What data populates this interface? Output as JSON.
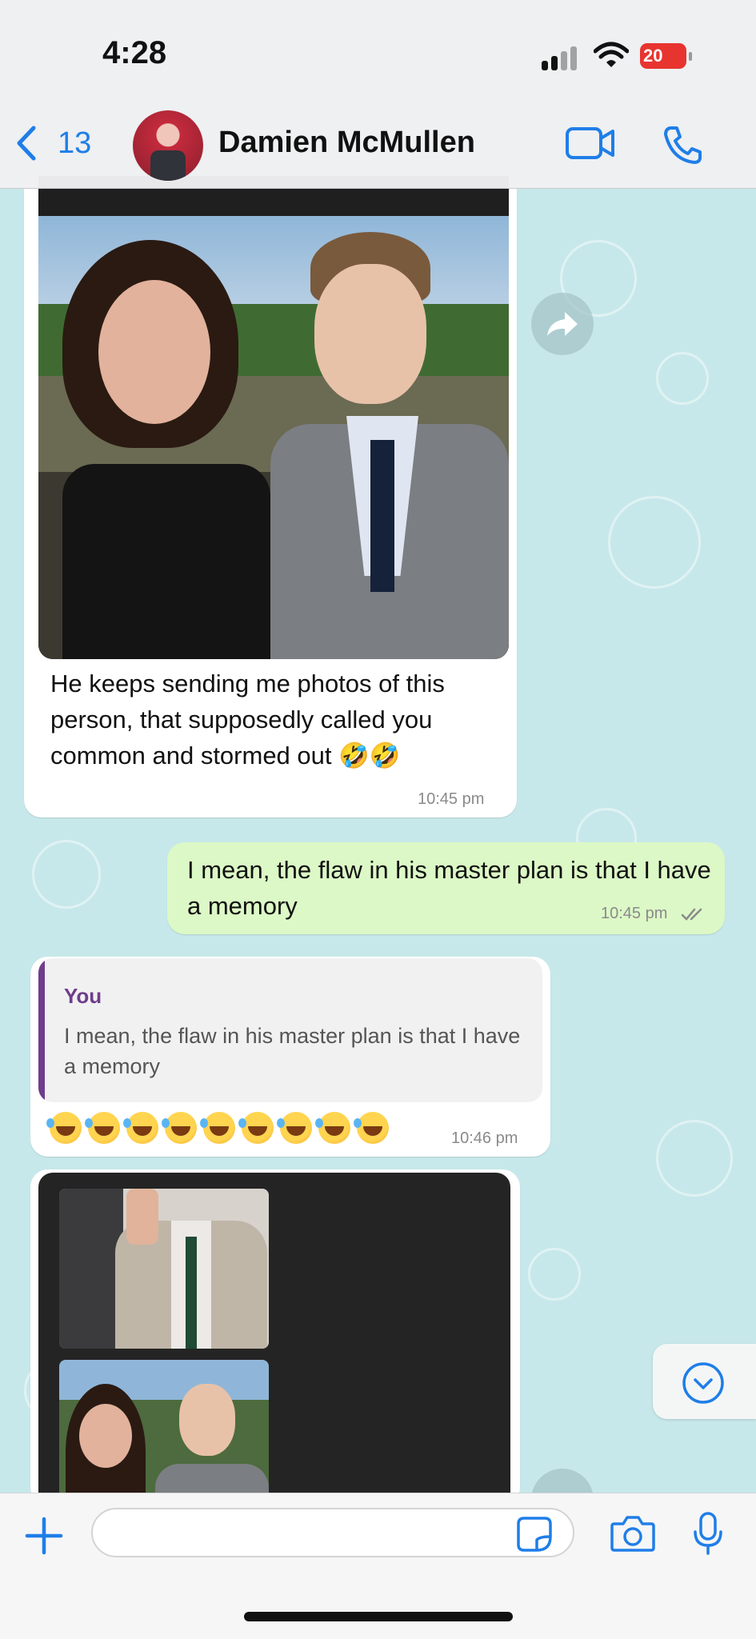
{
  "status_bar": {
    "time": "4:28",
    "battery": "20"
  },
  "header": {
    "back_count": "13",
    "contact_name": "Damien McMullen"
  },
  "messages": [
    {
      "direction": "in",
      "type": "photo_caption",
      "caption": "He keeps sending me photos of this person, that supposedly called you common and stormed out 🤣🤣",
      "time": "10:45 pm"
    },
    {
      "direction": "out",
      "type": "text",
      "text": "I mean, the flaw in his master plan is that I have a memory",
      "time": "10:45 pm",
      "status": "read"
    },
    {
      "direction": "in",
      "type": "reply",
      "quote_author": "You",
      "quote_text": "I mean, the flaw in his master plan is that I have a memory",
      "text": "🤣🤣🤣🤣🤣🤣🤣🤣🤣",
      "time": "10:46 pm"
    },
    {
      "direction": "in",
      "type": "photo_grid"
    }
  ],
  "icons": {
    "back": "chevron-left-icon",
    "video": "video-camera-icon",
    "call": "phone-icon",
    "forward": "forward-arrow-icon",
    "scroll": "chevron-down-circle-icon",
    "attach": "plus-icon",
    "sticker": "sticker-icon",
    "camera": "camera-icon",
    "mic": "microphone-icon"
  },
  "colors": {
    "accent": "#1f7ee8",
    "outgoing_bubble": "#dcf8c6",
    "quote_accent": "#6f3d8a",
    "chat_bg": "#c7e8ea"
  }
}
